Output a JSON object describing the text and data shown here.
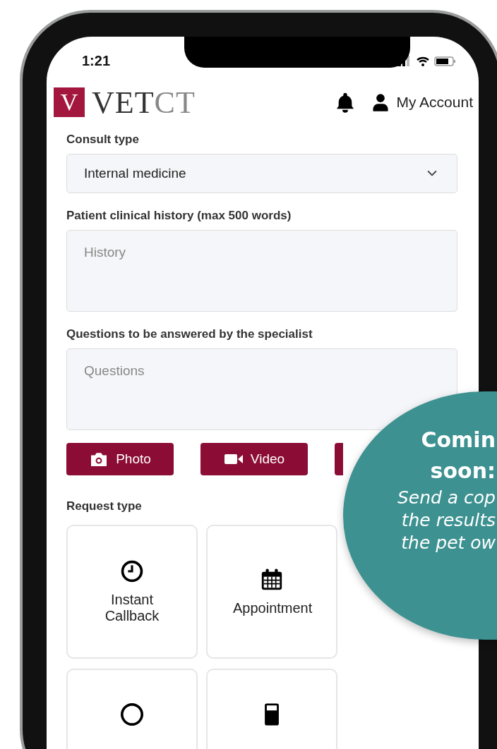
{
  "status_bar": {
    "time": "1:21"
  },
  "header": {
    "logo": {
      "mark": "V",
      "word_dark": "VET",
      "word_light": "CT"
    },
    "account_label": "My Account"
  },
  "form": {
    "fields": [
      {
        "kind": "select",
        "label": "Consult type",
        "value": "Internal medicine"
      },
      {
        "kind": "textarea",
        "label": "Patient clinical history (max 500 words)",
        "placeholder": "History"
      },
      {
        "kind": "textarea",
        "label": "Questions to be answered by the specialist",
        "placeholder": "Questions"
      }
    ],
    "attachments": [
      {
        "kind": "camera",
        "label": "Photo"
      },
      {
        "kind": "video",
        "label": "Video"
      },
      {
        "kind": "covered"
      }
    ],
    "request_type": {
      "label": "Request type",
      "options": [
        {
          "kind": "clock",
          "label": "Instant Callback"
        },
        {
          "kind": "calendar",
          "label": "Appointment"
        },
        {
          "kind": "circle"
        },
        {
          "kind": "device"
        }
      ]
    }
  },
  "promo": {
    "title_lines": [
      "Comin",
      "soon:"
    ],
    "body_lines": [
      "Send a cop",
      "the results",
      "the pet ow"
    ]
  }
}
